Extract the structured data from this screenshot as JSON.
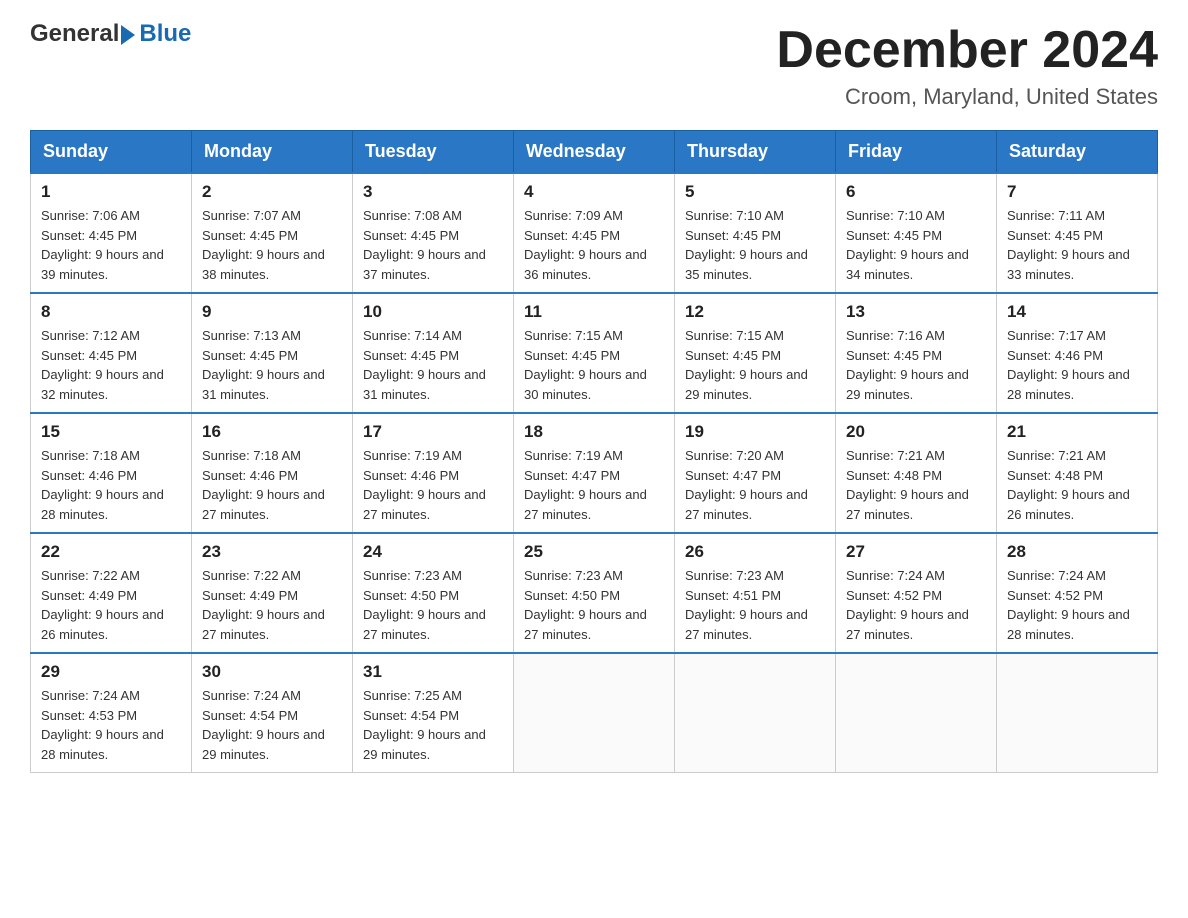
{
  "header": {
    "logo_general": "General",
    "logo_blue": "Blue",
    "month_title": "December 2024",
    "location": "Croom, Maryland, United States"
  },
  "days_of_week": [
    "Sunday",
    "Monday",
    "Tuesday",
    "Wednesday",
    "Thursday",
    "Friday",
    "Saturday"
  ],
  "weeks": [
    [
      {
        "day": "1",
        "sunrise": "7:06 AM",
        "sunset": "4:45 PM",
        "daylight": "9 hours and 39 minutes."
      },
      {
        "day": "2",
        "sunrise": "7:07 AM",
        "sunset": "4:45 PM",
        "daylight": "9 hours and 38 minutes."
      },
      {
        "day": "3",
        "sunrise": "7:08 AM",
        "sunset": "4:45 PM",
        "daylight": "9 hours and 37 minutes."
      },
      {
        "day": "4",
        "sunrise": "7:09 AM",
        "sunset": "4:45 PM",
        "daylight": "9 hours and 36 minutes."
      },
      {
        "day": "5",
        "sunrise": "7:10 AM",
        "sunset": "4:45 PM",
        "daylight": "9 hours and 35 minutes."
      },
      {
        "day": "6",
        "sunrise": "7:10 AM",
        "sunset": "4:45 PM",
        "daylight": "9 hours and 34 minutes."
      },
      {
        "day": "7",
        "sunrise": "7:11 AM",
        "sunset": "4:45 PM",
        "daylight": "9 hours and 33 minutes."
      }
    ],
    [
      {
        "day": "8",
        "sunrise": "7:12 AM",
        "sunset": "4:45 PM",
        "daylight": "9 hours and 32 minutes."
      },
      {
        "day": "9",
        "sunrise": "7:13 AM",
        "sunset": "4:45 PM",
        "daylight": "9 hours and 31 minutes."
      },
      {
        "day": "10",
        "sunrise": "7:14 AM",
        "sunset": "4:45 PM",
        "daylight": "9 hours and 31 minutes."
      },
      {
        "day": "11",
        "sunrise": "7:15 AM",
        "sunset": "4:45 PM",
        "daylight": "9 hours and 30 minutes."
      },
      {
        "day": "12",
        "sunrise": "7:15 AM",
        "sunset": "4:45 PM",
        "daylight": "9 hours and 29 minutes."
      },
      {
        "day": "13",
        "sunrise": "7:16 AM",
        "sunset": "4:45 PM",
        "daylight": "9 hours and 29 minutes."
      },
      {
        "day": "14",
        "sunrise": "7:17 AM",
        "sunset": "4:46 PM",
        "daylight": "9 hours and 28 minutes."
      }
    ],
    [
      {
        "day": "15",
        "sunrise": "7:18 AM",
        "sunset": "4:46 PM",
        "daylight": "9 hours and 28 minutes."
      },
      {
        "day": "16",
        "sunrise": "7:18 AM",
        "sunset": "4:46 PM",
        "daylight": "9 hours and 27 minutes."
      },
      {
        "day": "17",
        "sunrise": "7:19 AM",
        "sunset": "4:46 PM",
        "daylight": "9 hours and 27 minutes."
      },
      {
        "day": "18",
        "sunrise": "7:19 AM",
        "sunset": "4:47 PM",
        "daylight": "9 hours and 27 minutes."
      },
      {
        "day": "19",
        "sunrise": "7:20 AM",
        "sunset": "4:47 PM",
        "daylight": "9 hours and 27 minutes."
      },
      {
        "day": "20",
        "sunrise": "7:21 AM",
        "sunset": "4:48 PM",
        "daylight": "9 hours and 27 minutes."
      },
      {
        "day": "21",
        "sunrise": "7:21 AM",
        "sunset": "4:48 PM",
        "daylight": "9 hours and 26 minutes."
      }
    ],
    [
      {
        "day": "22",
        "sunrise": "7:22 AM",
        "sunset": "4:49 PM",
        "daylight": "9 hours and 26 minutes."
      },
      {
        "day": "23",
        "sunrise": "7:22 AM",
        "sunset": "4:49 PM",
        "daylight": "9 hours and 27 minutes."
      },
      {
        "day": "24",
        "sunrise": "7:23 AM",
        "sunset": "4:50 PM",
        "daylight": "9 hours and 27 minutes."
      },
      {
        "day": "25",
        "sunrise": "7:23 AM",
        "sunset": "4:50 PM",
        "daylight": "9 hours and 27 minutes."
      },
      {
        "day": "26",
        "sunrise": "7:23 AM",
        "sunset": "4:51 PM",
        "daylight": "9 hours and 27 minutes."
      },
      {
        "day": "27",
        "sunrise": "7:24 AM",
        "sunset": "4:52 PM",
        "daylight": "9 hours and 27 minutes."
      },
      {
        "day": "28",
        "sunrise": "7:24 AM",
        "sunset": "4:52 PM",
        "daylight": "9 hours and 28 minutes."
      }
    ],
    [
      {
        "day": "29",
        "sunrise": "7:24 AM",
        "sunset": "4:53 PM",
        "daylight": "9 hours and 28 minutes."
      },
      {
        "day": "30",
        "sunrise": "7:24 AM",
        "sunset": "4:54 PM",
        "daylight": "9 hours and 29 minutes."
      },
      {
        "day": "31",
        "sunrise": "7:25 AM",
        "sunset": "4:54 PM",
        "daylight": "9 hours and 29 minutes."
      },
      null,
      null,
      null,
      null
    ]
  ]
}
